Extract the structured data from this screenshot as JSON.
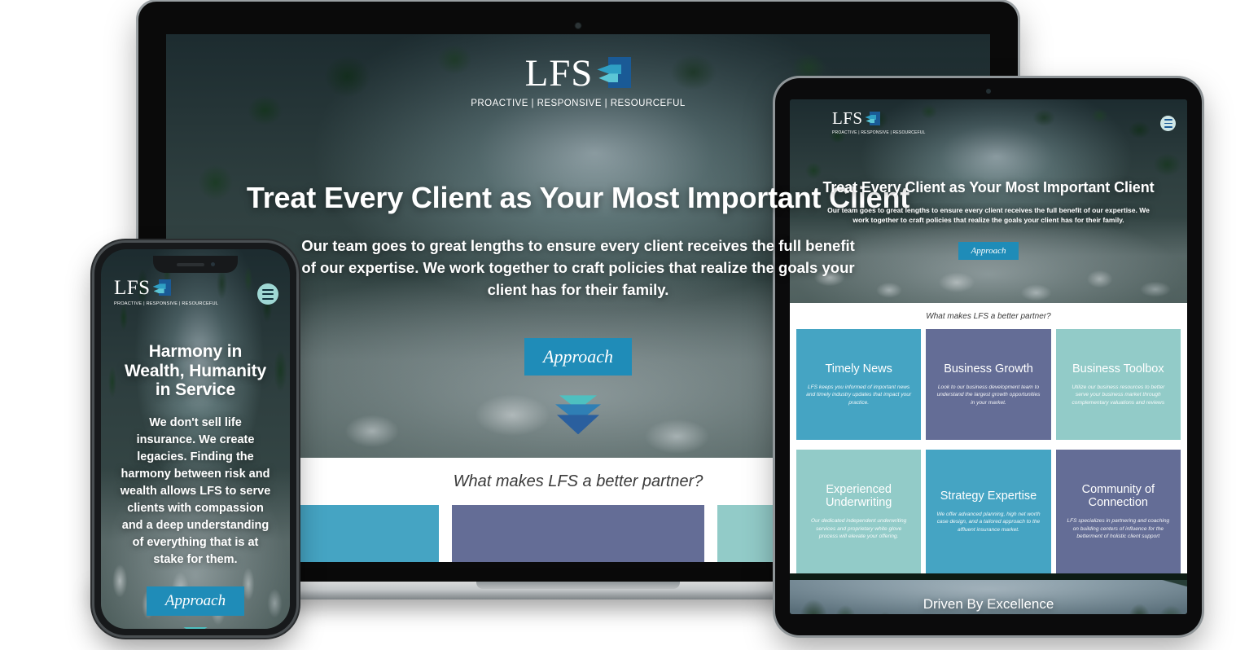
{
  "brand": {
    "name": "LFS",
    "tagline": "PROACTIVE | RESPONSIVE | RESOURCEFUL",
    "colors": {
      "accent_blue": "#1f8cb8",
      "logo_navy": "#1a5a96",
      "logo_teal": "#2f9fc4",
      "card_teal_blue": "#45a4c3",
      "card_slate": "#646d96",
      "card_light_teal": "#92cbc8",
      "menu_mint": "#9fd8d4"
    }
  },
  "nav": {
    "menu_icon": "hamburger-menu-icon"
  },
  "desktop": {
    "heading": "Treat Every Client as Your Most Important Client",
    "lead": "Our team goes to great lengths to ensure every client receives the full benefit of our expertise. We work together to craft policies that realize the goals your client has for their family.",
    "cta": "Approach",
    "scroll_icon": "chevron-down-icon",
    "partner_question": "What makes LFS a better partner?"
  },
  "tablet": {
    "heading": "Treat Every Client as Your Most Important Client",
    "lead": "Our team goes to great lengths to ensure every client receives the full benefit of our expertise. We work together to craft policies that realize the goals your client has for their family.",
    "cta": "Approach",
    "partner_question": "What makes LFS a better partner?",
    "excellence": "Driven By Excellence"
  },
  "phone": {
    "heading": "Harmony in Wealth, Humanity in Service",
    "lead": "We don't sell life insurance. We create legacies. Finding the harmony between risk and wealth allows LFS to serve clients with compassion and a deep understanding of everything that is at stake for them.",
    "cta": "Approach",
    "scroll_icon": "chevron-down-icon"
  },
  "cards": [
    {
      "title": "Timely News",
      "body": "LFS keeps you informed of important news and timely industry updates that impact your practice.",
      "color": "#45a4c3"
    },
    {
      "title": "Business Growth",
      "body": "Look to our business development team to understand the largest growth opportunities in your market.",
      "color": "#646d96"
    },
    {
      "title": "Business Toolbox",
      "body": "Utilize our business resources to better serve your business market through complementary valuations and reviews",
      "color": "#92cbc8"
    },
    {
      "title": "Experienced Underwriting",
      "body": "Our dedicated independent underwriting services and proprietary white glove process will elevate your offering.",
      "color": "#92cbc8"
    },
    {
      "title": "Strategy Expertise",
      "body": "We offer advanced planning, high net worth case design, and a tailored approach to the affluent insurance market.",
      "color": "#45a4c3"
    },
    {
      "title": "Community of Connection",
      "body": "LFS specializes in partnering and coaching on building centers of influence for the betterment of holistic client support",
      "color": "#646d96"
    }
  ]
}
